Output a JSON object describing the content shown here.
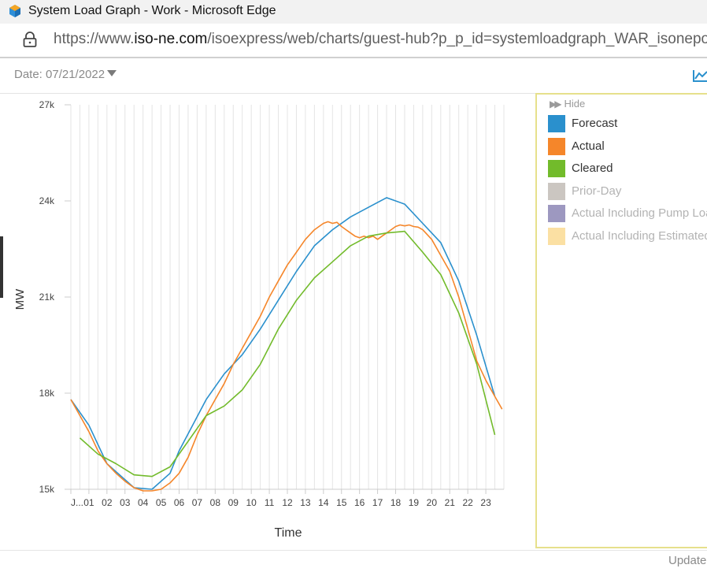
{
  "window": {
    "title": "System Load Graph - Work - Microsoft Edge",
    "app_icon": "edge-workspace-icon"
  },
  "address_bar": {
    "url_prefix": "https://www.",
    "url_domain": "iso-ne.com",
    "url_path": "/isoexpress/web/charts/guest-hub?p_p_id=systemloadgraph_WAR_isoneportlets",
    "lock_icon": "lock-icon"
  },
  "toolbar": {
    "date_label": "Date: 07/21/2022",
    "chart_type_icon": "line-chart-icon"
  },
  "legend": {
    "hide_label": "Hide",
    "items": [
      {
        "label": "Forecast",
        "color": "#2a90cd",
        "active": true
      },
      {
        "label": "Actual",
        "color": "#f5862a",
        "active": true
      },
      {
        "label": "Cleared",
        "color": "#72bb2b",
        "active": true
      },
      {
        "label": "Prior-Day",
        "color": "#cbc6c1",
        "active": false
      },
      {
        "label": "Actual Including Pump Load",
        "color": "#9d98c0",
        "active": false
      },
      {
        "label": "Actual Including Estimated",
        "color": "#fbe0a3",
        "active": false
      }
    ]
  },
  "footer": {
    "updated_label": "Updated"
  },
  "chart_data": {
    "type": "line",
    "xlabel": "Time",
    "ylabel": "MW",
    "ylim": [
      15000,
      27000
    ],
    "y_ticks": [
      15000,
      18000,
      21000,
      24000,
      27000
    ],
    "y_tick_labels": [
      "15k",
      "18k",
      "21k",
      "24k",
      "27k"
    ],
    "x_range": [
      0,
      24
    ],
    "x_ticks": [
      0,
      1,
      2,
      3,
      4,
      5,
      6,
      7,
      8,
      9,
      10,
      11,
      12,
      13,
      14,
      15,
      16,
      17,
      18,
      19,
      20,
      21,
      22,
      23
    ],
    "x_tick_labels": [
      "J...",
      "01",
      "02",
      "03",
      "04",
      "05",
      "06",
      "07",
      "08",
      "09",
      "10",
      "11",
      "12",
      "13",
      "14",
      "15",
      "16",
      "17",
      "18",
      "19",
      "20",
      "21",
      "22",
      "23"
    ],
    "grid": "vertical",
    "series": [
      {
        "name": "Forecast",
        "color": "#2a90cd",
        "x": [
          0,
          1,
          2,
          3,
          3.5,
          4.5,
          5.5,
          6,
          7.5,
          8.5,
          9.5,
          10.5,
          11.5,
          12.5,
          13.5,
          14.5,
          15.5,
          16.5,
          17.5,
          18.5,
          19.5,
          20.5,
          21.5,
          22.5,
          23.5
        ],
        "y": [
          17800,
          17000,
          15800,
          15300,
          15050,
          15000,
          15500,
          16200,
          17800,
          18600,
          19200,
          20000,
          20900,
          21800,
          22600,
          23100,
          23500,
          23800,
          24100,
          23900,
          23300,
          22700,
          21500,
          19800,
          17900
        ]
      },
      {
        "name": "Actual",
        "color": "#f5862a",
        "x": [
          0,
          0.5,
          1,
          1.5,
          2,
          2.5,
          3,
          3.5,
          4,
          4.5,
          5,
          5.5,
          6,
          6.5,
          7,
          7.5,
          8,
          8.5,
          9,
          9.5,
          10,
          10.5,
          11,
          11.5,
          12,
          12.5,
          13,
          13.5,
          14,
          14.25,
          14.5,
          14.75,
          15,
          15.25,
          15.5,
          15.75,
          16,
          16.25,
          16.5,
          16.75,
          17,
          17.25,
          17.5,
          17.75,
          18,
          18.25,
          18.5,
          18.75,
          19,
          19.25,
          19.5,
          20,
          20.5,
          21,
          21.5,
          22,
          22.5,
          23,
          23.5,
          23.9
        ],
        "y": [
          17800,
          17300,
          16800,
          16200,
          15800,
          15500,
          15250,
          15050,
          14950,
          14950,
          15000,
          15200,
          15500,
          16000,
          16700,
          17300,
          17800,
          18300,
          18900,
          19400,
          19900,
          20400,
          21000,
          21500,
          22000,
          22400,
          22800,
          23100,
          23300,
          23350,
          23300,
          23330,
          23200,
          23100,
          23000,
          22900,
          22850,
          22900,
          22850,
          22900,
          22800,
          22900,
          23000,
          23100,
          23200,
          23250,
          23220,
          23250,
          23200,
          23180,
          23100,
          22800,
          22300,
          21800,
          21000,
          20000,
          19000,
          18400,
          17900,
          17500
        ]
      },
      {
        "name": "Cleared",
        "color": "#72bb2b",
        "x": [
          0.5,
          1.5,
          2.5,
          3.5,
          4.5,
          5.5,
          6.5,
          7.5,
          8.5,
          9.5,
          10.5,
          11.5,
          12.5,
          13.5,
          14.5,
          15.5,
          16.5,
          17.5,
          18.5,
          19.5,
          20.5,
          21.5,
          22.5,
          23.5
        ],
        "y": [
          16600,
          16100,
          15800,
          15450,
          15400,
          15700,
          16500,
          17300,
          17600,
          18100,
          18900,
          20000,
          20900,
          21600,
          22100,
          22600,
          22900,
          23000,
          23050,
          22400,
          21700,
          20500,
          18900,
          16700
        ]
      }
    ]
  }
}
